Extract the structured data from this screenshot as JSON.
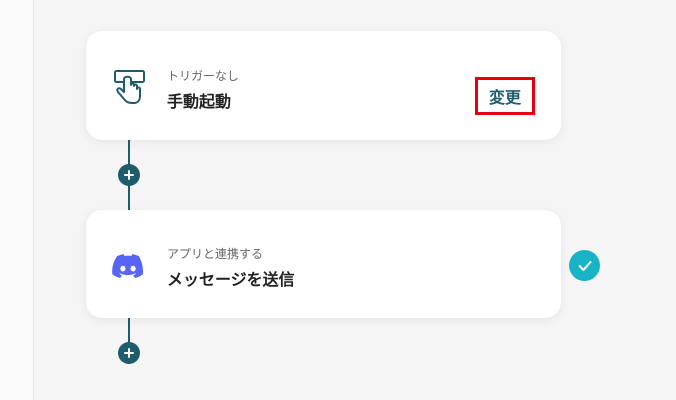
{
  "trigger_card": {
    "subtitle": "トリガーなし",
    "title": "手動起動",
    "change_label": "変更",
    "icon": "hand-pointer-icon"
  },
  "action_card": {
    "subtitle": "アプリと連携する",
    "title": "メッセージを送信",
    "icon": "discord-icon",
    "status": "check-icon",
    "status_color": "#19b3c7"
  },
  "colors": {
    "accent": "#1f5c6b",
    "highlight_border": "#e60012",
    "discord": "#5865f2"
  }
}
